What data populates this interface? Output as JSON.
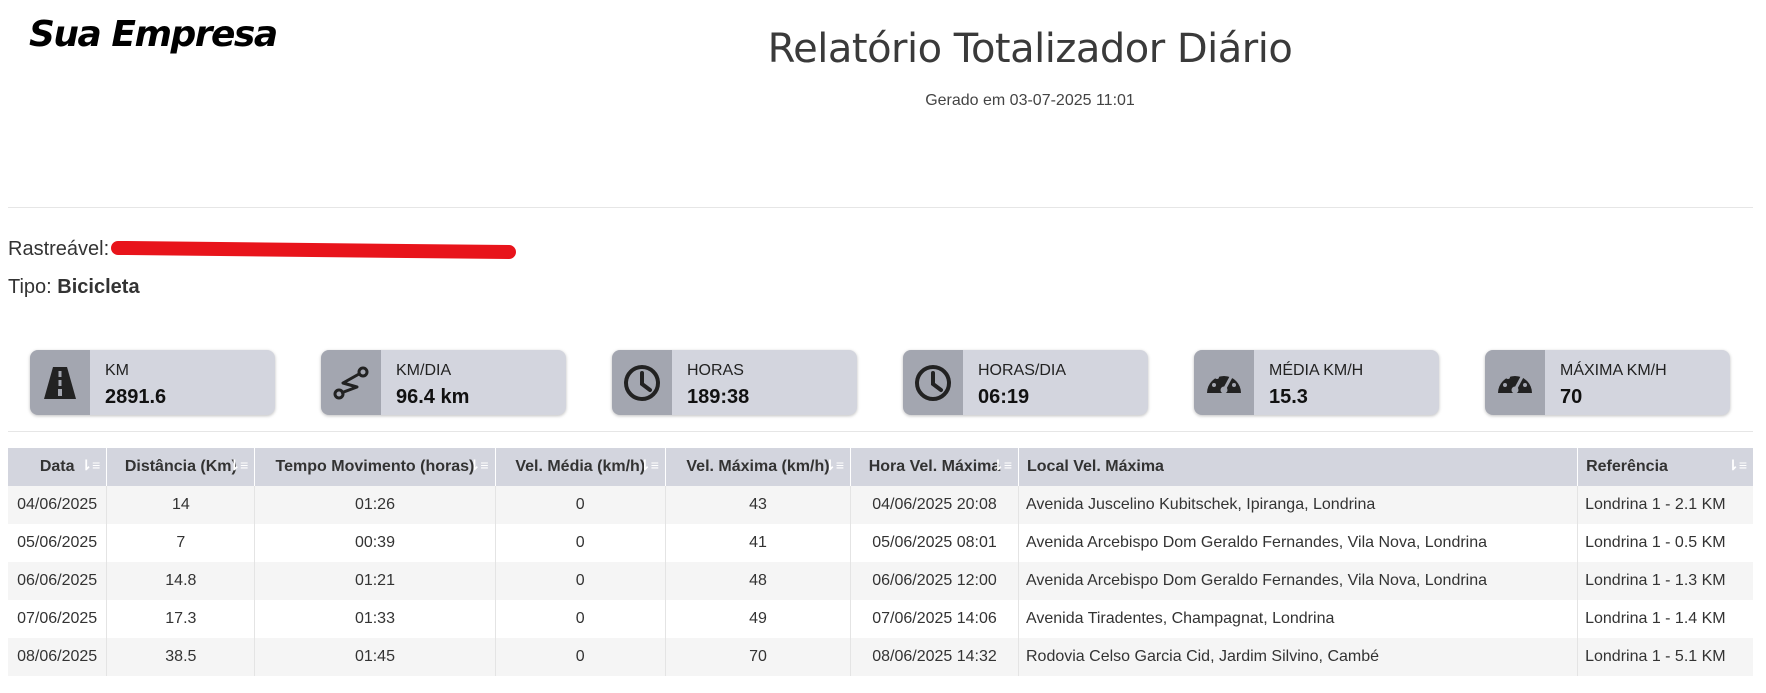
{
  "brand": {
    "logo": "Sua Empresa"
  },
  "report": {
    "title": "Relatório Totalizador Diário",
    "generated": "Gerado em 03-07-2025 11:01"
  },
  "info": {
    "tracked_label": "Rastreável:",
    "type_label": "Tipo:",
    "type_value": "Bicicleta"
  },
  "colors": {
    "card_bg": "#d3d5de",
    "icon_bg": "#a3a6b0",
    "header_bg": "#d3d5de",
    "redaction": "#e8141b"
  },
  "cards": [
    {
      "label": "KM",
      "value": "2891.6",
      "icon": "road-icon"
    },
    {
      "label": "KM/DIA",
      "value": "96.4 km",
      "icon": "route-icon"
    },
    {
      "label": "HORAS",
      "value": "189:38",
      "icon": "clock-icon"
    },
    {
      "label": "HORAS/DIA",
      "value": "06:19",
      "icon": "clock-icon"
    },
    {
      "label": "MÉDIA KM/H",
      "value": "15.3",
      "icon": "speedometer-icon"
    },
    {
      "label": "MÁXIMA KM/H",
      "value": "70",
      "icon": "speedometer-icon"
    }
  ],
  "table": {
    "headers": [
      "Data",
      "Distância (Km)",
      "Tempo Movimento (horas)",
      "Vel. Média (km/h)",
      "Vel. Máxima (km/h)",
      "Hora Vel. Máxima",
      "Local Vel. Máxima",
      "Referência"
    ],
    "rows": [
      [
        "04/06/2025",
        "14",
        "01:26",
        "0",
        "43",
        "04/06/2025 20:08",
        "Avenida Juscelino Kubitschek, Ipiranga, Londrina",
        "Londrina 1 - 2.1 KM"
      ],
      [
        "05/06/2025",
        "7",
        "00:39",
        "0",
        "41",
        "05/06/2025 08:01",
        "Avenida Arcebispo Dom Geraldo Fernandes, Vila Nova, Londrina",
        "Londrina 1 - 0.5 KM"
      ],
      [
        "06/06/2025",
        "14.8",
        "01:21",
        "0",
        "48",
        "06/06/2025 12:00",
        "Avenida Arcebispo Dom Geraldo Fernandes, Vila Nova, Londrina",
        "Londrina 1 - 1.3 KM"
      ],
      [
        "07/06/2025",
        "17.3",
        "01:33",
        "0",
        "49",
        "07/06/2025 14:06",
        "Avenida Tiradentes, Champagnat, Londrina",
        "Londrina 1 - 1.4 KM"
      ],
      [
        "08/06/2025",
        "38.5",
        "01:45",
        "0",
        "70",
        "08/06/2025 14:32",
        "Rodovia Celso Garcia Cid, Jardim Silvino, Cambé",
        "Londrina 1 - 5.1 KM"
      ]
    ]
  }
}
